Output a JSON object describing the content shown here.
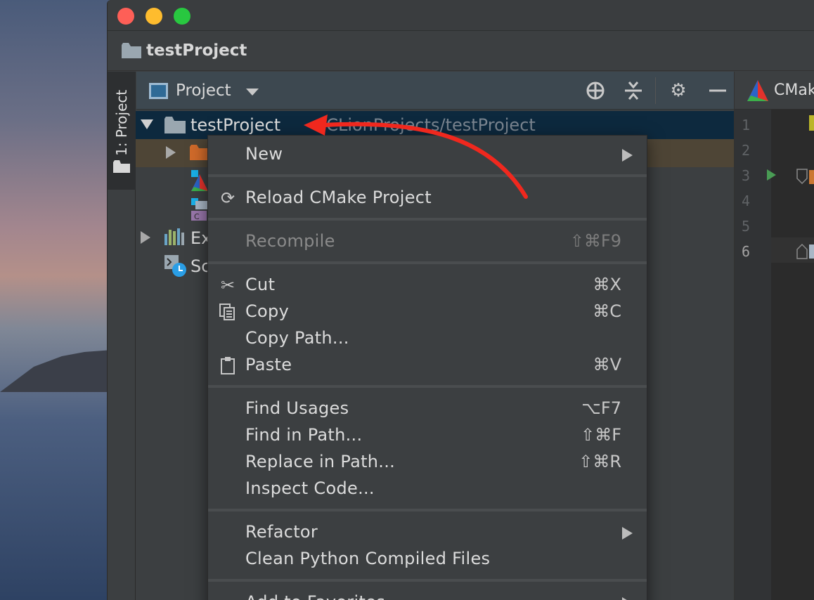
{
  "window": {
    "title": "testProject"
  },
  "tool_stripe": {
    "project_tab": "1: Project"
  },
  "project_panel": {
    "view_label": "Project",
    "icons": [
      "locate-icon",
      "collapse-all-icon",
      "gear-icon",
      "minimize-icon"
    ],
    "tree": {
      "root_name": "testProject",
      "root_path": "~/CLionProjects/testProject",
      "external_libraries": "Ex",
      "scratches": "Sc"
    }
  },
  "editor": {
    "tab_label": "CMak",
    "line_numbers": [
      "1",
      "2",
      "3",
      "4",
      "5",
      "6"
    ]
  },
  "context_menu": {
    "items": [
      {
        "label": "New",
        "shortcut": "",
        "submenu": true
      },
      {
        "label": "Reload CMake Project",
        "shortcut": "",
        "icon": "reload-icon"
      },
      {
        "label": "Recompile",
        "shortcut": "⇧⌘F9",
        "disabled": true
      },
      {
        "label": "Cut",
        "shortcut": "⌘X",
        "icon": "scissors-icon"
      },
      {
        "label": "Copy",
        "shortcut": "⌘C",
        "icon": "copy-icon"
      },
      {
        "label": "Copy Path...",
        "shortcut": ""
      },
      {
        "label": "Paste",
        "shortcut": "⌘V",
        "icon": "clipboard-icon"
      },
      {
        "label": "Find Usages",
        "shortcut": "⌥F7"
      },
      {
        "label": "Find in Path...",
        "shortcut": "⇧⌘F"
      },
      {
        "label": "Replace in Path...",
        "shortcut": "⇧⌘R"
      },
      {
        "label": "Inspect Code...",
        "shortcut": ""
      },
      {
        "label": "Refactor",
        "shortcut": "",
        "submenu": true
      },
      {
        "label": "Clean Python Compiled Files",
        "shortcut": ""
      },
      {
        "label": "Add to Favorites",
        "shortcut": "",
        "submenu": true
      }
    ]
  },
  "colors": {
    "annotation_arrow": "#f0281e",
    "selection": "#0d293e",
    "menu_bg": "#3c3f41"
  }
}
